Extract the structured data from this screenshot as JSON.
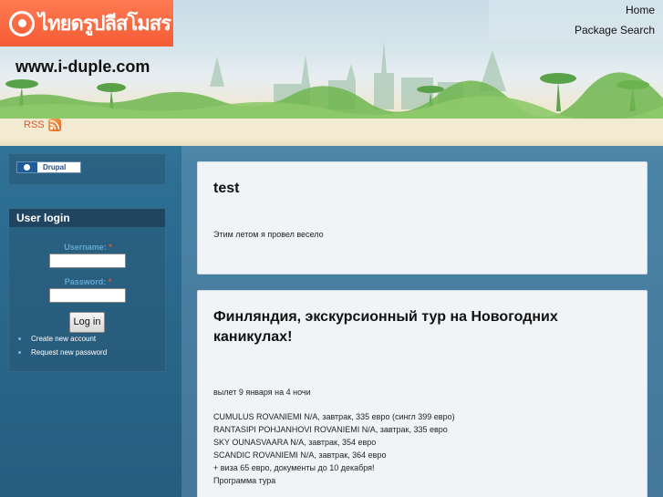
{
  "site": {
    "logo_text": "ไทยดรูปลีสโมสร",
    "name": "www.i-duple.com"
  },
  "nav": {
    "home": "Home",
    "package_search": "Package Search"
  },
  "rss": {
    "label": "RSS",
    "icon": "rss-icon"
  },
  "drupal_badge": {
    "label": "Drupal",
    "icon": "drupal-drop-icon"
  },
  "login": {
    "title": "User login",
    "username_label": "Username:",
    "password_label": "Password:",
    "required_mark": "*",
    "username_value": "",
    "password_value": "",
    "button": "Log in",
    "links": [
      "Create new account",
      "Request new password"
    ]
  },
  "posts": [
    {
      "title": "test",
      "body": "Этим летом я провел весело"
    },
    {
      "title": "Финляндия, экскурсионный тур на Новогодних каникулах!",
      "intro": "вылет 9 января на 4 ночи",
      "lines": [
        "CUMULUS ROVANIEMI N/A, завтрак, 335 евро (сингл 399 евро)",
        "RANTASIPI POHJANHOVI ROVANIEMI N/A, завтрак, 335 евро",
        "SKY OUNASVAARA N/A, завтрак, 354 евро",
        "SCANDIC ROVANIEMI N/A, завтрак, 364 евро",
        "+ виза 65 евро, документы до 10 декабря!",
        "Программа тура"
      ]
    }
  ],
  "colors": {
    "logo_bg": "#f45c35",
    "rss": "#d9572b",
    "label": "#63a8d3",
    "sidebar_title_bg": "#1e3c55",
    "page_bg": "#2d6f93"
  }
}
